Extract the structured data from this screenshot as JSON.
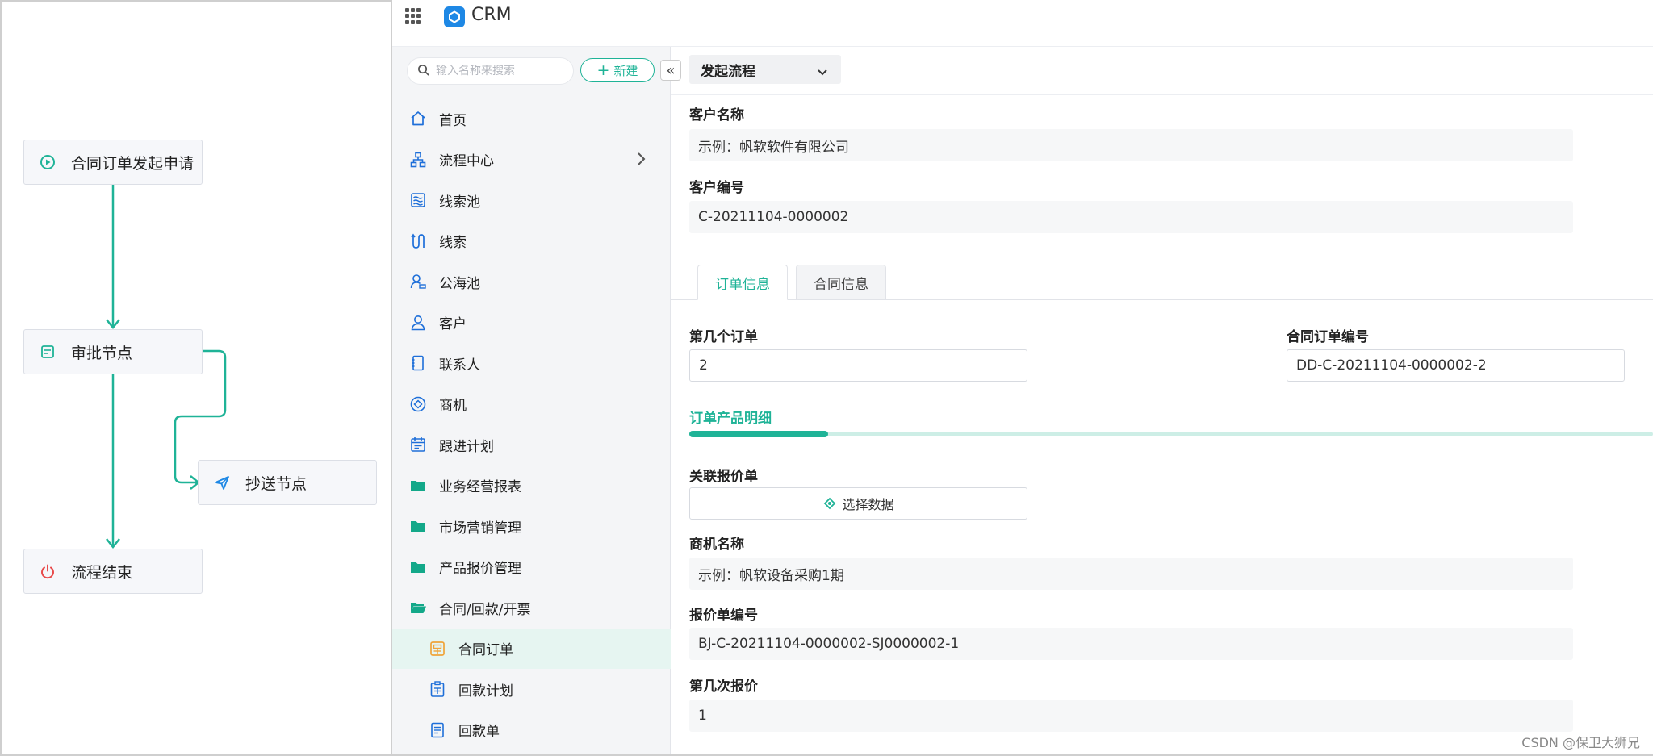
{
  "flow_diagram": {
    "nodes": [
      {
        "label": "合同订单发起申请",
        "icon": "play-circle-icon"
      },
      {
        "label": "审批节点",
        "icon": "approval-form-icon"
      },
      {
        "label": "抄送节点",
        "icon": "send-icon"
      },
      {
        "label": "流程结束",
        "icon": "power-icon"
      }
    ],
    "colors": {
      "line": "#1fb397",
      "end_icon": "#e84a4a"
    }
  },
  "app": {
    "title": "CRM",
    "apps_icon": "grid-icon"
  },
  "sidebar": {
    "search_placeholder": "输入名称来搜索",
    "new_button": "新建",
    "collapse_label": "«",
    "items": [
      {
        "label": "首页",
        "icon": "home-icon"
      },
      {
        "label": "流程中心",
        "icon": "flowchart-icon",
        "has_children": true
      },
      {
        "label": "线索池",
        "icon": "leads-pool-icon"
      },
      {
        "label": "线索",
        "icon": "leads-icon"
      },
      {
        "label": "公海池",
        "icon": "public-pool-icon"
      },
      {
        "label": "客户",
        "icon": "customer-icon"
      },
      {
        "label": "联系人",
        "icon": "contacts-book-icon"
      },
      {
        "label": "商机",
        "icon": "opportunity-icon"
      },
      {
        "label": "跟进计划",
        "icon": "calendar-icon"
      },
      {
        "label": "业务经营报表",
        "icon": "folder-icon"
      },
      {
        "label": "市场营销管理",
        "icon": "folder-icon"
      },
      {
        "label": "产品报价管理",
        "icon": "folder-icon"
      },
      {
        "label": "合同/回款/开票",
        "icon": "folder-open-icon"
      },
      {
        "label": "合同订单",
        "icon": "contract-icon",
        "active": true
      },
      {
        "label": "回款计划",
        "icon": "payment-plan-icon"
      },
      {
        "label": "回款单",
        "icon": "receipt-icon"
      }
    ]
  },
  "main": {
    "flow_select": "发起流程",
    "customer_name_label": "客户名称",
    "customer_name_value": "示例：帆软软件有限公司",
    "customer_no_label": "客户编号",
    "customer_no_value": "C-20211104-0000002",
    "tabs": [
      {
        "label": "订单信息",
        "active": true
      },
      {
        "label": "合同信息",
        "active": false
      }
    ],
    "order_index_label": "第几个订单",
    "order_index_value": "2",
    "contract_order_no_label": "合同订单编号",
    "contract_order_no_value": "DD-C-20211104-0000002-2",
    "section_title": "订单产品明细",
    "section_progress": 0.144,
    "quote_link_label": "关联报价单",
    "select_data_button": "选择数据",
    "opportunity_name_label": "商机名称",
    "opportunity_name_value": "示例：帆软设备采购1期",
    "quote_no_label": "报价单编号",
    "quote_no_value": "BJ-C-20211104-0000002-SJ0000002-1",
    "quote_index_label": "第几次报价",
    "quote_index_value": "1"
  },
  "watermark": "CSDN @保卫大狮兄",
  "colors": {
    "accent": "#1fb397",
    "brand": "#1e88e5"
  }
}
